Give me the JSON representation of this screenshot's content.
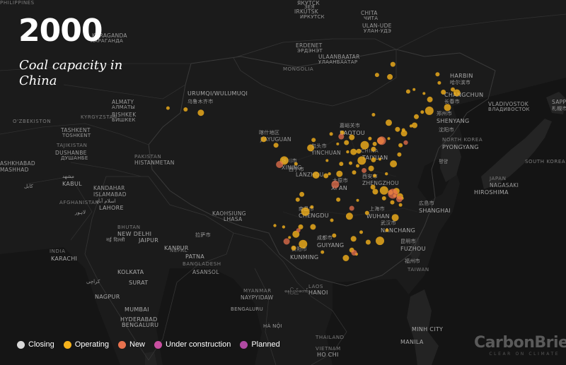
{
  "title": {
    "year": "2000",
    "subtitle": "Coal capacity in China"
  },
  "legend": [
    {
      "label": "Closing",
      "color": "#d8d8d8"
    },
    {
      "label": "Operating",
      "color": "#f5b21b"
    },
    {
      "label": "New",
      "color": "#e8724e"
    },
    {
      "label": "Under construction",
      "color": "#c94fa1"
    },
    {
      "label": "Planned",
      "color": "#b04aa3"
    }
  ],
  "brand": {
    "name": "CarbonBrief",
    "tagline": "CLEAR ON CLIMATE"
  },
  "place_labels": [
    {
      "text": "ЯКУТСК",
      "cls": "city"
    },
    {
      "text": "ЗЕЯ",
      "cls": "cn"
    },
    {
      "text": "IRKUTSK",
      "cls": "city"
    },
    {
      "text": "ИРКУТСК",
      "cls": "cn"
    },
    {
      "text": "CHITA",
      "cls": "city"
    },
    {
      "text": "ЧИТА",
      "cls": "cn"
    },
    {
      "text": "KARAGANDA",
      "cls": "city"
    },
    {
      "text": "КАРАГАНДА",
      "cls": "cn"
    },
    {
      "text": "ULAN-UDE",
      "cls": "city"
    },
    {
      "text": "УЛАН-УДЭ",
      "cls": "cn"
    },
    {
      "text": "ERDENET",
      "cls": "city"
    },
    {
      "text": "ЭРДЭНЭТ",
      "cls": "cn"
    },
    {
      "text": "ULAANBAATAR",
      "cls": "city"
    },
    {
      "text": "УЛААНБААТАР",
      "cls": "cn"
    },
    {
      "text": "MONGOLIA",
      "cls": "country"
    },
    {
      "text": "HARBIN",
      "cls": "big"
    },
    {
      "text": "哈尔滨市",
      "cls": "cn"
    },
    {
      "text": "CHANGCHUN",
      "cls": "big"
    },
    {
      "text": "长春市",
      "cls": "cn"
    },
    {
      "text": "VLADIVOSTOK",
      "cls": "city"
    },
    {
      "text": "ВЛАДИВОСТОК",
      "cls": "cn"
    },
    {
      "text": "SAPPORO",
      "cls": "city"
    },
    {
      "text": "札幌市",
      "cls": "cn"
    },
    {
      "text": "URUMQI/WULUMUQI",
      "cls": "big"
    },
    {
      "text": "乌鲁木齐市",
      "cls": "cn"
    },
    {
      "text": "ALMATY",
      "cls": "city"
    },
    {
      "text": "АЛМАТЫ",
      "cls": "cn"
    },
    {
      "text": "BISHKEK",
      "cls": "city"
    },
    {
      "text": "БИШКЕК",
      "cls": "cn"
    },
    {
      "text": "KYRGYZSTAN",
      "cls": "country"
    },
    {
      "text": "O'ZBEKISTON",
      "cls": "country"
    },
    {
      "text": "TASHKENT",
      "cls": "city"
    },
    {
      "text": "TOSHKENT",
      "cls": "cn"
    },
    {
      "text": "TAJIKISTAN",
      "cls": "country"
    },
    {
      "text": "DUSHANBE",
      "cls": "city"
    },
    {
      "text": "ДУШАНБЕ",
      "cls": "cn"
    },
    {
      "text": "ASHKHABAD",
      "cls": "city"
    },
    {
      "text": "MASHHAD",
      "cls": "city"
    },
    {
      "text": "مشهد",
      "cls": "cn"
    },
    {
      "text": "KABUL",
      "cls": "big"
    },
    {
      "text": "کابل",
      "cls": "cn"
    },
    {
      "text": "AFGHANISTAN",
      "cls": "country"
    },
    {
      "text": "KANDAHAR",
      "cls": "city"
    },
    {
      "text": "ISLAMABAD",
      "cls": "city"
    },
    {
      "text": "اسلام آباد",
      "cls": "cn"
    },
    {
      "text": "LAHORE",
      "cls": "big"
    },
    {
      "text": "لاہور",
      "cls": "cn"
    },
    {
      "text": "PAKISTAN",
      "cls": "country"
    },
    {
      "text": "HISTANMETAN",
      "cls": "city"
    },
    {
      "text": "喀什地区",
      "cls": "cn"
    },
    {
      "text": "JIAYUGUAN",
      "cls": "city"
    },
    {
      "text": "嘉峪关市",
      "cls": "cn"
    },
    {
      "text": "BAOTOU",
      "cls": "big"
    },
    {
      "text": "包头市",
      "cls": "cn"
    },
    {
      "text": "YINCHUAN",
      "cls": "city"
    },
    {
      "text": "银川市",
      "cls": "cn"
    },
    {
      "text": "XINING",
      "cls": "city"
    },
    {
      "text": "西宁市",
      "cls": "cn"
    },
    {
      "text": "LANZHOU",
      "cls": "city"
    },
    {
      "text": "CHINA",
      "cls": "country"
    },
    {
      "text": "TAIYUAN",
      "cls": "big"
    },
    {
      "text": "太原市",
      "cls": "cn"
    },
    {
      "text": "XI'AN",
      "cls": "big"
    },
    {
      "text": "西安市",
      "cls": "cn"
    },
    {
      "text": "ZHENGZHOU",
      "cls": "city"
    },
    {
      "text": "郑州市",
      "cls": "cn"
    },
    {
      "text": "SHENYANG",
      "cls": "big"
    },
    {
      "text": "沈阳市",
      "cls": "cn"
    },
    {
      "text": "NORTH KOREA",
      "cls": "country"
    },
    {
      "text": "PYONGYANG",
      "cls": "big"
    },
    {
      "text": "평양",
      "cls": "cn"
    },
    {
      "text": "SOUTH KOREA",
      "cls": "country"
    },
    {
      "text": "JAPAN",
      "cls": "country"
    },
    {
      "text": "HIROSHIMA",
      "cls": "big"
    },
    {
      "text": "NAGASAKI",
      "cls": "city"
    },
    {
      "text": "広島市",
      "cls": "cn"
    },
    {
      "text": "SHANGHAI",
      "cls": "big"
    },
    {
      "text": "上海市",
      "cls": "cn"
    },
    {
      "text": "WUHAN",
      "cls": "big"
    },
    {
      "text": "武汉市",
      "cls": "cn"
    },
    {
      "text": "NANCHANG",
      "cls": "big"
    },
    {
      "text": "南昌市",
      "cls": "cn"
    },
    {
      "text": "CHENGDU",
      "cls": "big"
    },
    {
      "text": "成都市",
      "cls": "cn"
    },
    {
      "text": "GUIYANG",
      "cls": "big"
    },
    {
      "text": "贵阳市",
      "cls": "cn"
    },
    {
      "text": "KUNMING",
      "cls": "big"
    },
    {
      "text": "昆明市",
      "cls": "cn"
    },
    {
      "text": "FUZHOU",
      "cls": "big"
    },
    {
      "text": "福州市",
      "cls": "cn"
    },
    {
      "text": "TAIWAN",
      "cls": "country"
    },
    {
      "text": "KAOHSIUNG",
      "cls": "city"
    },
    {
      "text": "LHASA",
      "cls": "city"
    },
    {
      "text": "拉萨市",
      "cls": "cn"
    },
    {
      "text": "BHUTAN",
      "cls": "country"
    },
    {
      "text": "NEW DELHI",
      "cls": "big"
    },
    {
      "text": "नई दिल्ली",
      "cls": "cn"
    },
    {
      "text": "JAIPUR",
      "cls": "big"
    },
    {
      "text": "KANPUR",
      "cls": "big"
    },
    {
      "text": "NEPAL",
      "cls": "country"
    },
    {
      "text": "PATNA",
      "cls": "big"
    },
    {
      "text": "BANGLADESH",
      "cls": "country"
    },
    {
      "text": "ASANSOL",
      "cls": "city"
    },
    {
      "text": "KOLKATA",
      "cls": "big"
    },
    {
      "text": "INDIA",
      "cls": "country"
    },
    {
      "text": "KARACHI",
      "cls": "big"
    },
    {
      "text": "کراچی",
      "cls": "cn"
    },
    {
      "text": "SURAT",
      "cls": "big"
    },
    {
      "text": "NAGPUR",
      "cls": "big"
    },
    {
      "text": "MUMBAI",
      "cls": "big"
    },
    {
      "text": "HYDERABAD",
      "cls": "big"
    },
    {
      "text": "BENGALURU",
      "cls": "big"
    },
    {
      "text": "BENGALURU",
      "cls": "cn"
    },
    {
      "text": "MYANMAR",
      "cls": "country"
    },
    {
      "text": "NAYPYIDAW",
      "cls": "city"
    },
    {
      "text": "နေပြည်တော်",
      "cls": "cn"
    },
    {
      "text": "LAOS",
      "cls": "country"
    },
    {
      "text": "HANOI",
      "cls": "big"
    },
    {
      "text": "HÀ NỘI",
      "cls": "cn"
    },
    {
      "text": "THAILAND",
      "cls": "country"
    },
    {
      "text": "VIETNAM",
      "cls": "country"
    },
    {
      "text": "HO CHI",
      "cls": "big"
    },
    {
      "text": "MINH CITY",
      "cls": "big"
    },
    {
      "text": "MANILA",
      "cls": "big"
    },
    {
      "text": "PHILIPPINES",
      "cls": "country"
    }
  ],
  "chart_data": {
    "type": "scatter",
    "title": "2000",
    "subtitle": "Coal capacity in China",
    "categories": [
      "Closing",
      "Operating",
      "New",
      "Under construction",
      "Planned"
    ],
    "series": [
      {
        "name": "Operating",
        "points": [
          {
            "lon": 127.9,
            "lat": 49.6
          },
          {
            "lon": 128.2,
            "lat": 48.3
          },
          {
            "lon": 126.6,
            "lat": 45.8
          },
          {
            "lon": 128.9,
            "lat": 46.9
          },
          {
            "lon": 125.6,
            "lat": 46.7
          },
          {
            "lon": 131.2,
            "lat": 46.8
          },
          {
            "lon": 130.5,
            "lat": 47.3
          },
          {
            "lon": 125.3,
            "lat": 43.9
          },
          {
            "lon": 126.5,
            "lat": 44.1
          },
          {
            "lon": 124.3,
            "lat": 43.2
          },
          {
            "lon": 123.4,
            "lat": 41.8
          },
          {
            "lon": 122.2,
            "lat": 40.7
          },
          {
            "lon": 121.6,
            "lat": 38.9
          },
          {
            "lon": 122.1,
            "lat": 41.2
          },
          {
            "lon": 124.0,
            "lat": 41.9
          },
          {
            "lon": 121.1,
            "lat": 41.3
          },
          {
            "lon": 119.6,
            "lat": 39.9
          },
          {
            "lon": 118.2,
            "lat": 39.6
          },
          {
            "lon": 117.2,
            "lat": 39.1
          },
          {
            "lon": 116.4,
            "lat": 39.9
          },
          {
            "lon": 115.5,
            "lat": 38.9
          },
          {
            "lon": 114.5,
            "lat": 38.0
          },
          {
            "lon": 112.6,
            "lat": 37.9
          },
          {
            "lon": 113.6,
            "lat": 37.9
          },
          {
            "lon": 111.7,
            "lat": 40.8
          },
          {
            "lon": 109.8,
            "lat": 40.6
          },
          {
            "lon": 113.3,
            "lat": 40.1
          },
          {
            "lon": 112.4,
            "lat": 39.3
          },
          {
            "lon": 110.9,
            "lat": 39.1
          },
          {
            "lon": 106.3,
            "lat": 38.5
          },
          {
            "lon": 106.8,
            "lat": 39.7
          },
          {
            "lon": 103.8,
            "lat": 36.1
          },
          {
            "lon": 101.8,
            "lat": 36.6
          },
          {
            "lon": 108.9,
            "lat": 34.3
          },
          {
            "lon": 109.5,
            "lat": 34.6
          },
          {
            "lon": 111.2,
            "lat": 34.6
          },
          {
            "lon": 113.7,
            "lat": 34.8
          },
          {
            "lon": 114.3,
            "lat": 35.8
          },
          {
            "lon": 116.6,
            "lat": 35.4
          },
          {
            "lon": 117.0,
            "lat": 36.7
          },
          {
            "lon": 118.1,
            "lat": 36.8
          },
          {
            "lon": 120.4,
            "lat": 36.1
          },
          {
            "lon": 121.4,
            "lat": 37.5
          },
          {
            "lon": 117.2,
            "lat": 34.3
          },
          {
            "lon": 118.8,
            "lat": 32.1
          },
          {
            "lon": 119.9,
            "lat": 31.8
          },
          {
            "lon": 120.6,
            "lat": 31.3
          },
          {
            "lon": 121.5,
            "lat": 31.2
          },
          {
            "lon": 120.2,
            "lat": 30.3
          },
          {
            "lon": 121.6,
            "lat": 29.9
          },
          {
            "lon": 117.3,
            "lat": 31.9
          },
          {
            "lon": 116.9,
            "lat": 32.6
          },
          {
            "lon": 114.3,
            "lat": 30.6
          },
          {
            "lon": 112.9,
            "lat": 28.2
          },
          {
            "lon": 115.9,
            "lat": 28.7
          },
          {
            "lon": 119.3,
            "lat": 26.1
          },
          {
            "lon": 118.1,
            "lat": 24.5
          },
          {
            "lon": 113.3,
            "lat": 23.1
          },
          {
            "lon": 114.1,
            "lat": 22.5
          },
          {
            "lon": 112.3,
            "lat": 21.9
          },
          {
            "lon": 110.3,
            "lat": 25.3
          },
          {
            "lon": 108.3,
            "lat": 22.8
          },
          {
            "lon": 106.7,
            "lat": 26.6
          },
          {
            "lon": 104.6,
            "lat": 26.6
          },
          {
            "lon": 102.7,
            "lat": 25.0
          },
          {
            "lon": 103.8,
            "lat": 25.5
          },
          {
            "lon": 104.1,
            "lat": 30.7
          },
          {
            "lon": 106.5,
            "lat": 29.6
          },
          {
            "lon": 105.4,
            "lat": 28.9
          },
          {
            "lon": 104.8,
            "lat": 31.5
          },
          {
            "lon": 101.7,
            "lat": 26.6
          },
          {
            "lon": 87.6,
            "lat": 43.8
          },
          {
            "lon": 85.0,
            "lat": 44.3
          },
          {
            "lon": 82.0,
            "lat": 44.5
          },
          {
            "lon": 98.3,
            "lat": 39.8
          },
          {
            "lon": 100.4,
            "lat": 38.9
          },
          {
            "lon": 109.1,
            "lat": 36.6
          },
          {
            "lon": 107.2,
            "lat": 34.4
          },
          {
            "lon": 111.5,
            "lat": 36.1
          },
          {
            "lon": 113.1,
            "lat": 36.2
          },
          {
            "lon": 115.0,
            "lat": 36.6
          },
          {
            "lon": 117.0,
            "lat": 38.3
          },
          {
            "lon": 119.2,
            "lat": 34.6
          },
          {
            "lon": 120.9,
            "lat": 32.0
          },
          {
            "lon": 111.0,
            "lat": 30.7
          },
          {
            "lon": 109.9,
            "lat": 27.6
          },
          {
            "lon": 113.6,
            "lat": 24.8
          },
          {
            "lon": 116.1,
            "lat": 24.3
          },
          {
            "lon": 121.9,
            "lat": 30.9
          },
          {
            "lon": 120.7,
            "lat": 28.0
          },
          {
            "lon": 118.8,
            "lat": 30.9
          },
          {
            "lon": 114.9,
            "lat": 25.8
          },
          {
            "lon": 105.0,
            "lat": 24.0
          },
          {
            "lon": 103.4,
            "lat": 23.4
          },
          {
            "lon": 100.2,
            "lat": 26.8
          },
          {
            "lon": 119.6,
            "lat": 42.3
          },
          {
            "lon": 122.9,
            "lat": 47.0
          },
          {
            "lon": 117.0,
            "lat": 43.5
          },
          {
            "lon": 119.8,
            "lat": 49.2
          },
          {
            "lon": 120.3,
            "lat": 51.1
          },
          {
            "lon": 123.9,
            "lat": 47.3
          },
          {
            "lon": 129.6,
            "lat": 44.6
          },
          {
            "lon": 117.6,
            "lat": 49.5
          }
        ]
      },
      {
        "name": "New",
        "points": [
          {
            "lon": 111.5,
            "lat": 40.2
          },
          {
            "lon": 118.4,
            "lat": 39.6
          },
          {
            "lon": 122.5,
            "lat": 39.3
          },
          {
            "lon": 121.4,
            "lat": 30.8
          },
          {
            "lon": 120.3,
            "lat": 31.6
          },
          {
            "lon": 113.3,
            "lat": 29.4
          },
          {
            "lon": 113.7,
            "lat": 22.7
          },
          {
            "lon": 110.5,
            "lat": 33.0
          },
          {
            "lon": 104.2,
            "lat": 26.1
          },
          {
            "lon": 102.2,
            "lat": 24.4
          },
          {
            "lon": 101.0,
            "lat": 36.0
          },
          {
            "lon": 115.4,
            "lat": 35.1
          }
        ]
      }
    ]
  }
}
